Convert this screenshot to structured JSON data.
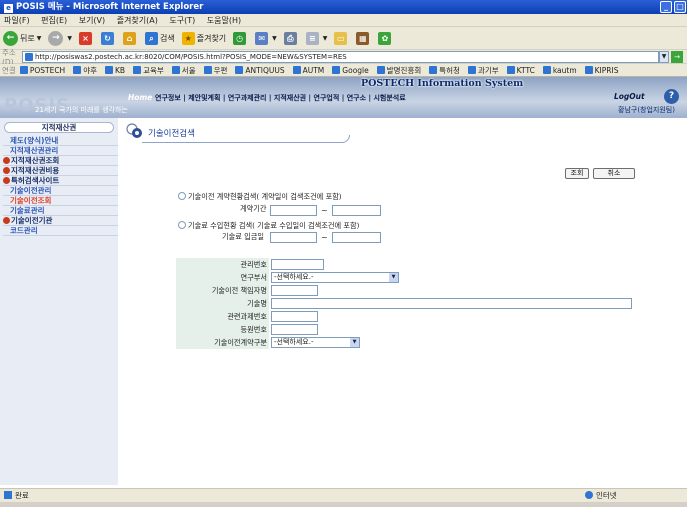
{
  "window": {
    "title": "POSIS 메뉴 - Microsoft Internet Explorer"
  },
  "menu": [
    "파일(F)",
    "편집(E)",
    "보기(V)",
    "즐겨찾기(A)",
    "도구(T)",
    "도움말(H)"
  ],
  "toolbar": {
    "back_label": "뒤로",
    "search_label": "검색",
    "favorites_label": "즐겨찾기"
  },
  "address": {
    "label": "주소(D)",
    "url": "http://posiswas2.postech.ac.kr:8020/COM/POSIS.html?POSIS_MODE=NEW&SYSTEM=RES"
  },
  "links": {
    "label": "연결",
    "items": [
      "POSTECH",
      "야후",
      "KB",
      "교육부",
      "서울",
      "우편",
      "ANTIQUUS",
      "AUTM",
      "Google",
      "발명진흥회",
      "특허청",
      "과기부",
      "KTTC",
      "kautm",
      "KIPRIS"
    ]
  },
  "banner": {
    "bg_text": "POSIS",
    "system_title": "POSTECH Information System",
    "slogan": "21세기 국가의 미래를 생각하는",
    "home": "Home",
    "topnav": "연구정보 | 제안및계획 | 연구과제관리 | 지적재산권 | 연구업적 | 연구소 | 시험분석료",
    "logout": "LogOut",
    "user": "황남구(창업지원팀)"
  },
  "sidebar": {
    "header": "지적재산권",
    "items": [
      {
        "label": "제도(양식)안내",
        "type": "sub"
      },
      {
        "label": "지적재산권관리",
        "type": "sub"
      },
      {
        "label": "지적재산권조회",
        "type": "bullet"
      },
      {
        "label": "지적재산권비용",
        "type": "bullet"
      },
      {
        "label": "특허검색사이트",
        "type": "bullet"
      },
      {
        "label": "기술이전관리",
        "type": "sub"
      },
      {
        "label": "기술이전조회",
        "type": "active"
      },
      {
        "label": "기술료관리",
        "type": "sub"
      },
      {
        "label": "기술이전기관",
        "type": "bullet"
      },
      {
        "label": "코드관리",
        "type": "sub"
      }
    ]
  },
  "page": {
    "title": "기술이전검색",
    "search_button": "조회",
    "cancel_button": "취소",
    "contract_radio_label": "기술이전 계약현황검색( 계약일이 검색조건에 포함)",
    "contract_period_label": "계약기간",
    "income_radio_label": "기술료 수입현황 검색( 기술료 수입일이 검색조건에 포함)",
    "income_date_label": "기술료 입금일",
    "dash": "~"
  },
  "form": {
    "mgmt_no": "관리번호",
    "dept": "연구부서",
    "dept_value": "-선택하세요.-",
    "responsible": "기술이전 책임자명",
    "tech_name": "기술명",
    "project_no": "관련과제번호",
    "reg_no": "등원번호",
    "contract_type": "기술이전계약구분",
    "contract_type_value": "-선택하세요.-"
  },
  "status": {
    "text": "완료",
    "zone": "인터넷"
  },
  "colors": {
    "titlebar": "#0b3fb3",
    "sidebar_bg": "#e8ecf4",
    "form_label_bg": "#e5f0ea",
    "active_menu": "#e0402a"
  }
}
